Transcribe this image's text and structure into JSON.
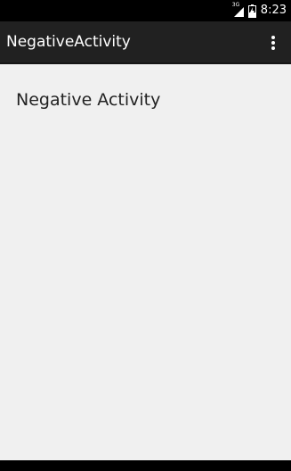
{
  "status_bar": {
    "network_label": "3G",
    "time": "8:23",
    "icons": {
      "signal": "signal-icon",
      "battery": "battery-charging-icon"
    }
  },
  "action_bar": {
    "title": "NegativeActivity",
    "overflow_icon": "more-vertical-icon"
  },
  "content": {
    "text": "Negative Activity"
  },
  "colors": {
    "status_bar_bg": "#000000",
    "action_bar_bg": "#212121",
    "content_bg": "#f0f0f0",
    "content_text": "#222222"
  }
}
